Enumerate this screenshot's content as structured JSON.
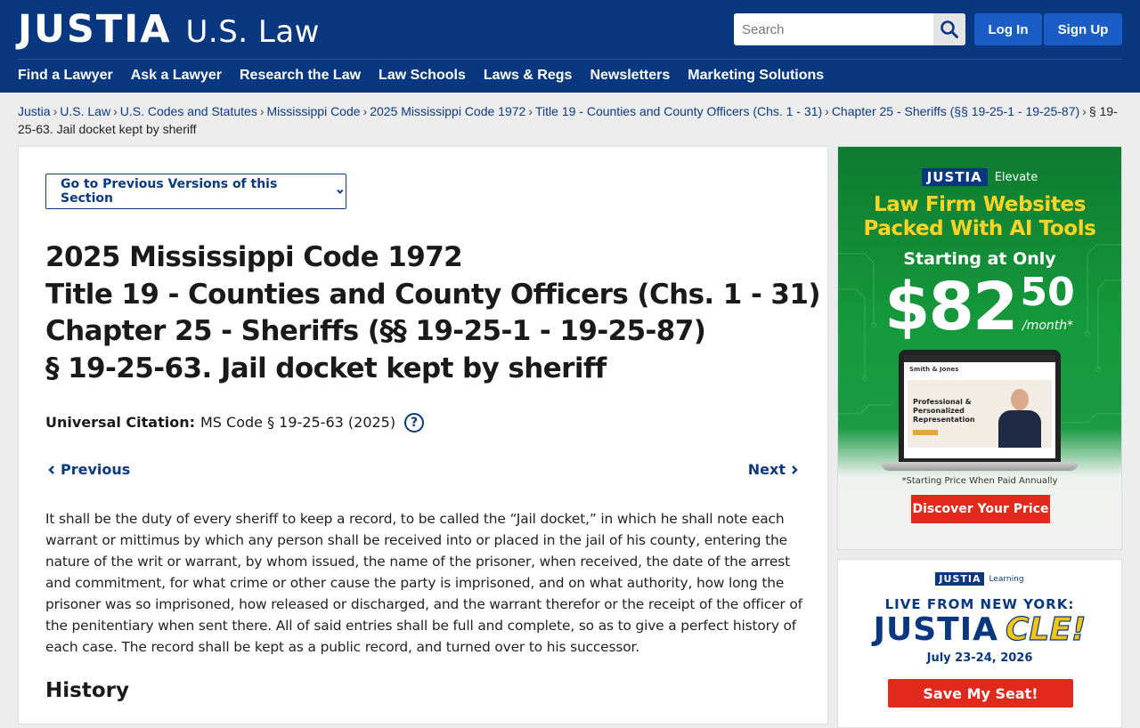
{
  "header": {
    "logo_main": "JUSTIA",
    "logo_sub": "U.S. Law",
    "search_placeholder": "Search",
    "login_label": "Log In",
    "signup_label": "Sign Up",
    "nav": [
      "Find a Lawyer",
      "Ask a Lawyer",
      "Research the Law",
      "Law Schools",
      "Laws & Regs",
      "Newsletters",
      "Marketing Solutions"
    ]
  },
  "breadcrumb": {
    "items": [
      "Justia",
      "U.S. Law",
      "U.S. Codes and Statutes",
      "Mississippi Code",
      "2025 Mississippi Code 1972",
      "Title 19 - Counties and County Officers (Chs. 1 - 31)",
      "Chapter 25 - Sheriffs (§§ 19-25-1 - 19-25-87)"
    ],
    "current": "19-25-63. Jail docket kept by sheriff",
    "final_sep": "§"
  },
  "main": {
    "prev_versions_label": "Go to Previous Versions of this Section",
    "heading": {
      "line1": "2025 Mississippi Code 1972",
      "line2": "Title 19 - Counties and County Officers (Chs. 1 - 31)",
      "line3": "Chapter 25 - Sheriffs (§§ 19-25-1 - 19-25-87)",
      "line4": "§ 19-25-63. Jail docket kept by sheriff"
    },
    "citation_label": "Universal Citation:",
    "citation_value": "MS Code § 19-25-63 (2025)",
    "help_glyph": "?",
    "previous_label": "Previous",
    "next_label": "Next",
    "body": "It shall be the duty of every sheriff to keep a record, to be called the “Jail docket,” in which he shall note each warrant or mittimus by which any person shall be received into or placed in the jail of his county, entering the nature of the writ or warrant, by whom issued, the name of the prisoner, when received, the date of the arrest and commitment, for what crime or other cause the party is imprisoned, and on what authority, how long the prisoner was so imprisoned, how released or discharged, and the warrant therefor or the receipt of the officer of the penitentiary when sent there. All of said entries shall be full and complete, so as to give a perfect history of each case. The record shall be kept as a public record, and turned over to his successor.",
    "history_label": "History"
  },
  "ad_elevate": {
    "brand": "JUSTIA",
    "sub": "Elevate",
    "headline1": "Law Firm Websites",
    "headline2": "Packed With AI Tools",
    "starting": "Starting at Only",
    "price_dollars": "$82",
    "price_cents": "50",
    "price_unit": "/month*",
    "site_logo": "Smith & Jones",
    "site_hero": "Professional & Personalized Representation",
    "note": "*Starting Price When Paid Annually",
    "cta": "Discover Your Price"
  },
  "ad_cle": {
    "brand": "JUSTIA",
    "sub": "Learning",
    "live": "LIVE FROM NEW YORK:",
    "title_a": "JUSTIA",
    "title_b": "CLE!",
    "date": "July 23-24, 2026",
    "cta": "Save My Seat!"
  },
  "colors": {
    "header_bg": "#0a3880",
    "link": "#0b3a82",
    "button_blue": "#1b5dc6",
    "cta_red": "#e12a1c",
    "ad_green": "#159a3b",
    "ad_yellow": "#ffd426"
  },
  "icons": [
    "search-icon",
    "chevron-down-icon",
    "help-icon",
    "chevron-left-icon",
    "chevron-right-icon"
  ]
}
